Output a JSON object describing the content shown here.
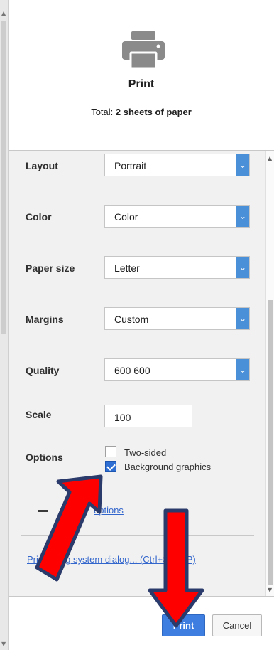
{
  "header": {
    "icon": "printer-icon",
    "title": "Print",
    "total_prefix": "Total: ",
    "total_value": "2 sheets of paper"
  },
  "settings": {
    "layout": {
      "label": "Layout",
      "value": "Portrait"
    },
    "color": {
      "label": "Color",
      "value": "Color"
    },
    "paper_size": {
      "label": "Paper size",
      "value": "Letter"
    },
    "margins": {
      "label": "Margins",
      "value": "Custom"
    },
    "quality": {
      "label": "Quality",
      "value": "600 600"
    },
    "scale": {
      "label": "Scale",
      "value": "100"
    },
    "options": {
      "label": "Options",
      "two_sided": {
        "label": "Two-sided",
        "checked": false
      },
      "background_graphics": {
        "label": "Background graphics",
        "checked": true
      }
    },
    "fewer_options": {
      "icon": "collapse-minus-icon",
      "label": "options"
    },
    "system_dialog": {
      "label": "Print using system dialog... (Ctrl+Shift+P)"
    }
  },
  "footer": {
    "print_label": "Print",
    "cancel_label": "Cancel"
  },
  "colors": {
    "accent_blue": "#3d7ee0",
    "dropdown_blue": "#4a90d9",
    "link_blue": "#3366cc",
    "annotation_arrow_fill": "#ff0000",
    "annotation_arrow_outline": "#2a3a6a"
  }
}
